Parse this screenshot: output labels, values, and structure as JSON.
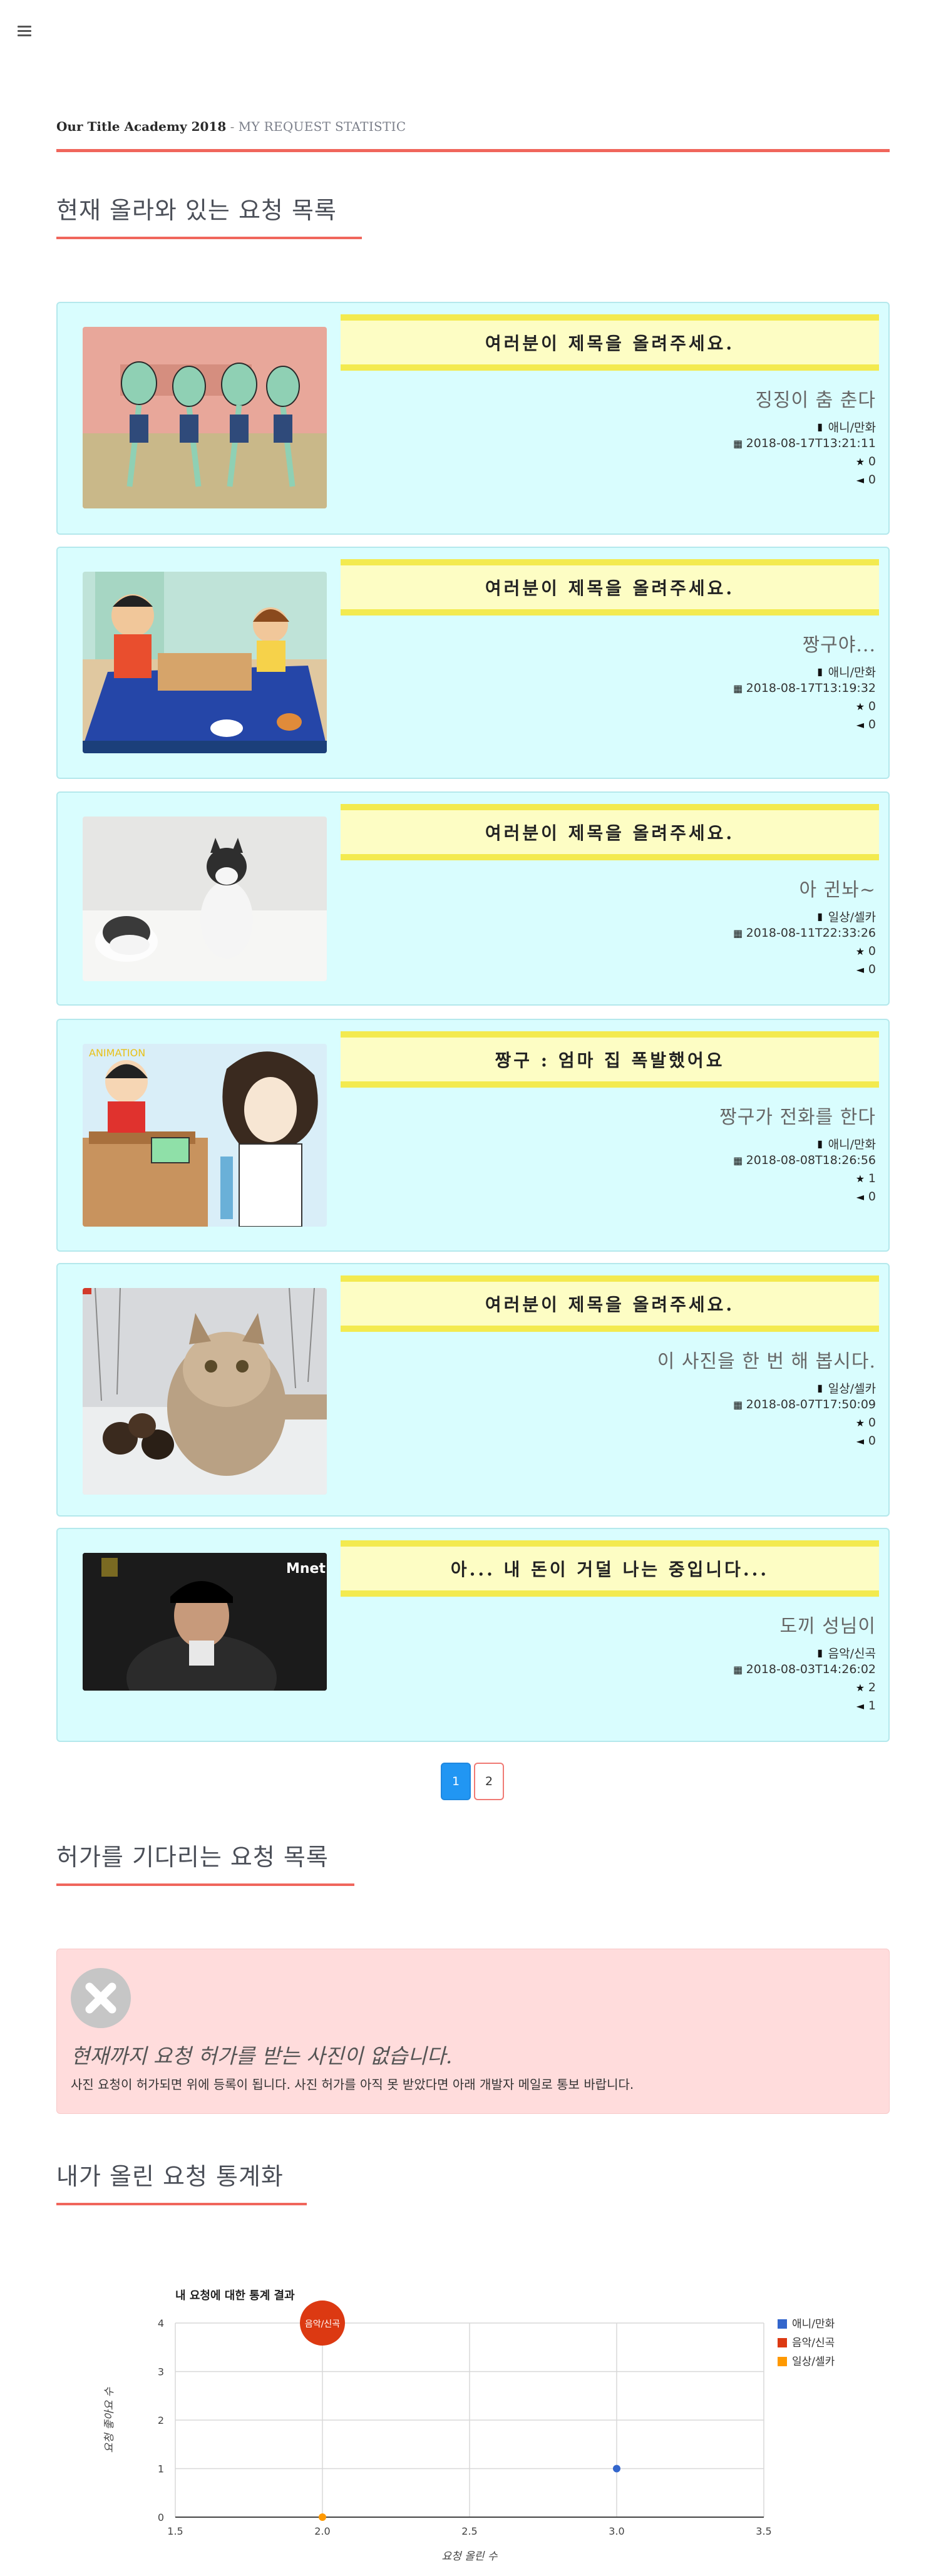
{
  "header": {
    "academy": "Our Title Academy 2018",
    "separator": " - ",
    "subtitle": "MY REQUEST STATISTIC"
  },
  "sections": {
    "current": "현재 올라와 있는 요청 목록",
    "pending": "허가를 기다리는 요청 목록",
    "stats": "내가 올린 요청 통계화"
  },
  "requests": [
    {
      "banner": "여러분이 제목을 올려주세요.",
      "title": "징징이 춤 춘다",
      "category": "애니/만화",
      "date": "2018-08-17T13:21:11",
      "stars": "0",
      "comments": "0",
      "image": "dancing-squid-cartoon"
    },
    {
      "banner": "여러분이 제목을 올려주세요.",
      "title": "짱구야...",
      "category": "애니/만화",
      "date": "2018-08-17T13:19:32",
      "stars": "0",
      "comments": "0",
      "image": "family-at-table-cartoon"
    },
    {
      "banner": "여러분이 제목을 올려주세요.",
      "title": "아 귄놔~",
      "category": "일상/셀카",
      "date": "2018-08-11T22:33:26",
      "stars": "0",
      "comments": "0",
      "image": "two-cats-on-sofa"
    },
    {
      "banner": "짱구 : 엄마 집 폭발했어요",
      "title": "짱구가 전화를 한다",
      "category": "애니/만화",
      "date": "2018-08-08T18:26:56",
      "stars": "1",
      "comments": "0",
      "image": "boy-on-phone-cartoon"
    },
    {
      "banner": "여러분이 제목을 올려주세요.",
      "title": "이 사진을 한 번 해 봅시다.",
      "category": "일상/셀카",
      "date": "2018-08-07T17:50:09",
      "stars": "0",
      "comments": "0",
      "image": "cat-selfie-in-snow"
    },
    {
      "banner": "아... 내 돈이 거덜 나는 중입니다...",
      "title": "도끼 성님이",
      "category": "음악/신곡",
      "date": "2018-08-03T14:26:02",
      "stars": "2",
      "comments": "1",
      "image": "rapper-tv-screenshot"
    }
  ],
  "icons": {
    "category": "book-icon",
    "date": "calendar-icon",
    "stars": "star-icon",
    "comments": "comments-icon"
  },
  "pagination": {
    "pages": [
      "1",
      "2"
    ],
    "active": "1"
  },
  "notice": {
    "title": "현재까지 요청 허가를 받는 사진이 없습니다.",
    "text": "사진 요청이 허가되면 위에 등록이 됩니다. 사진 허가를 아직 못 받았다면 아래 개발자 메일로 통보 바랍니다."
  },
  "colors": {
    "accent": "#f0665c",
    "card_bg": "#d9fdfe",
    "banner_bg": "#fdfdc4",
    "banner_border": "#f3ea4f",
    "notice_bg": "#ffdcdc",
    "active_page": "#2196f3"
  },
  "chart_data": {
    "type": "scatter",
    "title": "내 요청에 대한 통계 결과",
    "xlabel": "요청 올린 수",
    "ylabel": "요청 좋아요 수",
    "xlim": [
      1.5,
      3.5
    ],
    "ylim": [
      0,
      4
    ],
    "xticks": [
      "1.5",
      "2.0",
      "2.5",
      "3.0",
      "3.5"
    ],
    "yticks": [
      "0",
      "1",
      "2",
      "3",
      "4"
    ],
    "grid": true,
    "legend_position": "right",
    "series": [
      {
        "name": "애니/만화",
        "color": "#3366cc",
        "points": [
          {
            "x": 3,
            "y": 1,
            "label": ""
          }
        ]
      },
      {
        "name": "음악/신곡",
        "color": "#dc3912",
        "points": [
          {
            "x": 2,
            "y": 4,
            "label": "음악/신곡"
          }
        ]
      },
      {
        "name": "일상/셀카",
        "color": "#ff9900",
        "points": [
          {
            "x": 2,
            "y": 0,
            "label": ""
          }
        ]
      }
    ]
  }
}
